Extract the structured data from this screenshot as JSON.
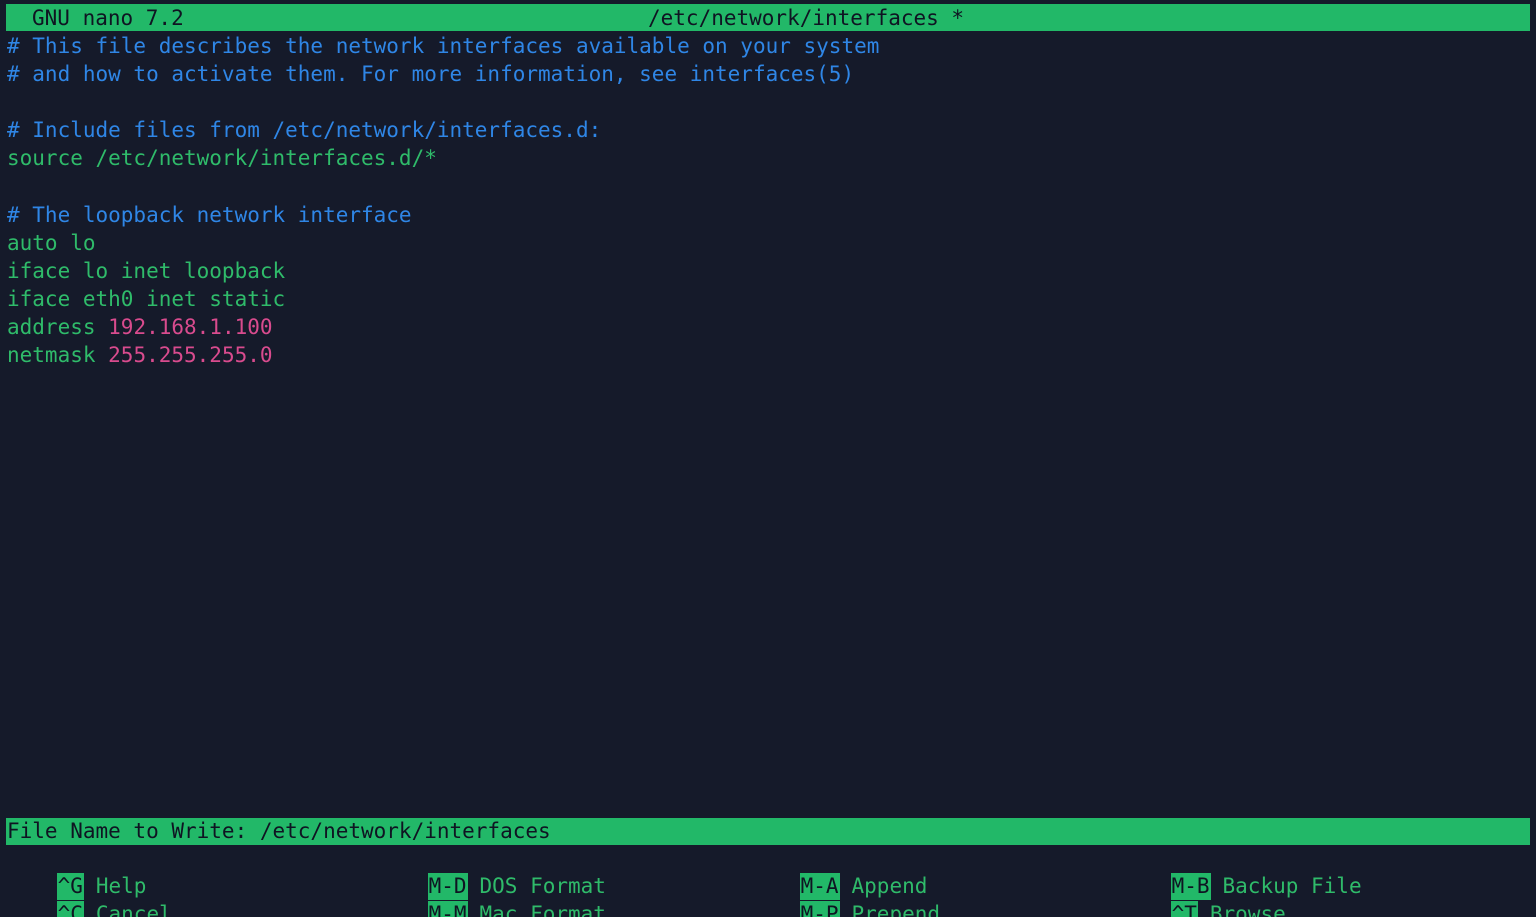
{
  "titlebar": {
    "app": "GNU nano 7.2",
    "file": "/etc/network/interfaces *"
  },
  "editor": {
    "lines": [
      {
        "parts": [
          {
            "text": "# This file describes the network interfaces available on your system",
            "style": "comment"
          }
        ]
      },
      {
        "parts": [
          {
            "text": "# and how to activate them. For more information, see interfaces(5)",
            "style": "comment"
          }
        ]
      },
      {
        "parts": []
      },
      {
        "parts": [
          {
            "text": "# Include files from /etc/network/interfaces.d:",
            "style": "comment"
          }
        ]
      },
      {
        "parts": [
          {
            "text": "source /etc/network/interfaces.d/*",
            "style": "code"
          }
        ]
      },
      {
        "parts": []
      },
      {
        "parts": [
          {
            "text": "# The loopback network interface",
            "style": "comment"
          }
        ]
      },
      {
        "parts": [
          {
            "text": "auto lo",
            "style": "code"
          }
        ]
      },
      {
        "parts": [
          {
            "text": "iface lo inet loopback",
            "style": "code"
          }
        ]
      },
      {
        "parts": [
          {
            "text": "iface eth0 inet static",
            "style": "code"
          }
        ]
      },
      {
        "parts": [
          {
            "text": "address ",
            "style": "code"
          },
          {
            "text": "192.168.1.100",
            "style": "num"
          }
        ]
      },
      {
        "parts": [
          {
            "text": "netmask ",
            "style": "code"
          },
          {
            "text": "255.255.255.0",
            "style": "num"
          }
        ]
      }
    ]
  },
  "prompt": {
    "text": "File Name to Write: /etc/network/interfaces"
  },
  "shortcuts": {
    "help": {
      "key": "^G",
      "label": "Help"
    },
    "cancel": {
      "key": "^C",
      "label": "Cancel"
    },
    "dos_format": {
      "key": "M-D",
      "label": "DOS Format"
    },
    "mac_format": {
      "key": "M-M",
      "label": "Mac Format"
    },
    "append": {
      "key": "M-A",
      "label": "Append"
    },
    "prepend": {
      "key": "M-P",
      "label": "Prepend"
    },
    "backup_file": {
      "key": "M-B",
      "label": "Backup File"
    },
    "browse": {
      "key": "^T",
      "label": "Browse"
    }
  },
  "colors": {
    "background": "#151a2a",
    "bar": "#22b868",
    "comment": "#2f86e6",
    "code": "#2fbb6a",
    "number": "#d94b8e"
  }
}
